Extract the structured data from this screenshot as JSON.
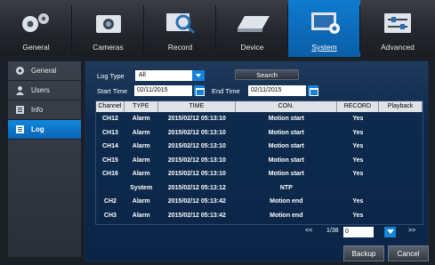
{
  "tabs": [
    {
      "label": "General",
      "icon": "gears-icon",
      "active": false
    },
    {
      "label": "Cameras",
      "icon": "camera-icon",
      "active": false
    },
    {
      "label": "Record",
      "icon": "magnifier-icon",
      "active": false
    },
    {
      "label": "Device",
      "icon": "hard-drive-icon",
      "active": false
    },
    {
      "label": "System",
      "icon": "monitor-settings-icon",
      "active": true
    },
    {
      "label": "Advanced",
      "icon": "advanced-settings-icon",
      "active": false
    }
  ],
  "sidebar": {
    "items": [
      {
        "label": "General",
        "icon": "gear-icon",
        "active": false
      },
      {
        "label": "Users",
        "icon": "user-icon",
        "active": false
      },
      {
        "label": "Info",
        "icon": "info-icon",
        "active": false
      },
      {
        "label": "Log",
        "icon": "log-icon",
        "active": true
      }
    ]
  },
  "filters": {
    "log_type_label": "Log Type",
    "log_type_value": "All",
    "search_label": "Search",
    "start_time_label": "Start Time",
    "start_time_value": "02/11/2015",
    "end_time_label": "End Time",
    "end_time_value": "02/11/2015"
  },
  "table": {
    "headers": [
      "Channel",
      "TYPE",
      "TIME",
      "CON.",
      "RECORD",
      "Playback"
    ],
    "rows": [
      [
        "CH12",
        "Alarm",
        "2015/02/12 05:13:10",
        "Motion start",
        "Yes",
        ""
      ],
      [
        "CH13",
        "Alarm",
        "2015/02/12 05:13:10",
        "Motion start",
        "Yes",
        ""
      ],
      [
        "CH14",
        "Alarm",
        "2015/02/12 05:13:10",
        "Motion start",
        "Yes",
        ""
      ],
      [
        "CH15",
        "Alarm",
        "2015/02/12 05:13:10",
        "Motion start",
        "Yes",
        ""
      ],
      [
        "CH16",
        "Alarm",
        "2015/02/12 05:13:10",
        "Motion start",
        "Yes",
        ""
      ],
      [
        "",
        "System",
        "2015/02/12 05:13:12",
        "NTP",
        "",
        ""
      ],
      [
        "CH2",
        "Alarm",
        "2015/02/12 05:13:42",
        "Motion end",
        "Yes",
        ""
      ],
      [
        "CH3",
        "Alarm",
        "2015/02/12 05:13:42",
        "Motion end",
        "Yes",
        ""
      ]
    ]
  },
  "pager": {
    "prev_label": "<<",
    "page_count": "1/38",
    "page_input": "0",
    "next_label": ">>"
  },
  "buttons": {
    "backup_label": "Backup",
    "cancel_label": "Cancel"
  },
  "colors": {
    "accent": "#0f7bd0",
    "panel": "#0b2548"
  }
}
